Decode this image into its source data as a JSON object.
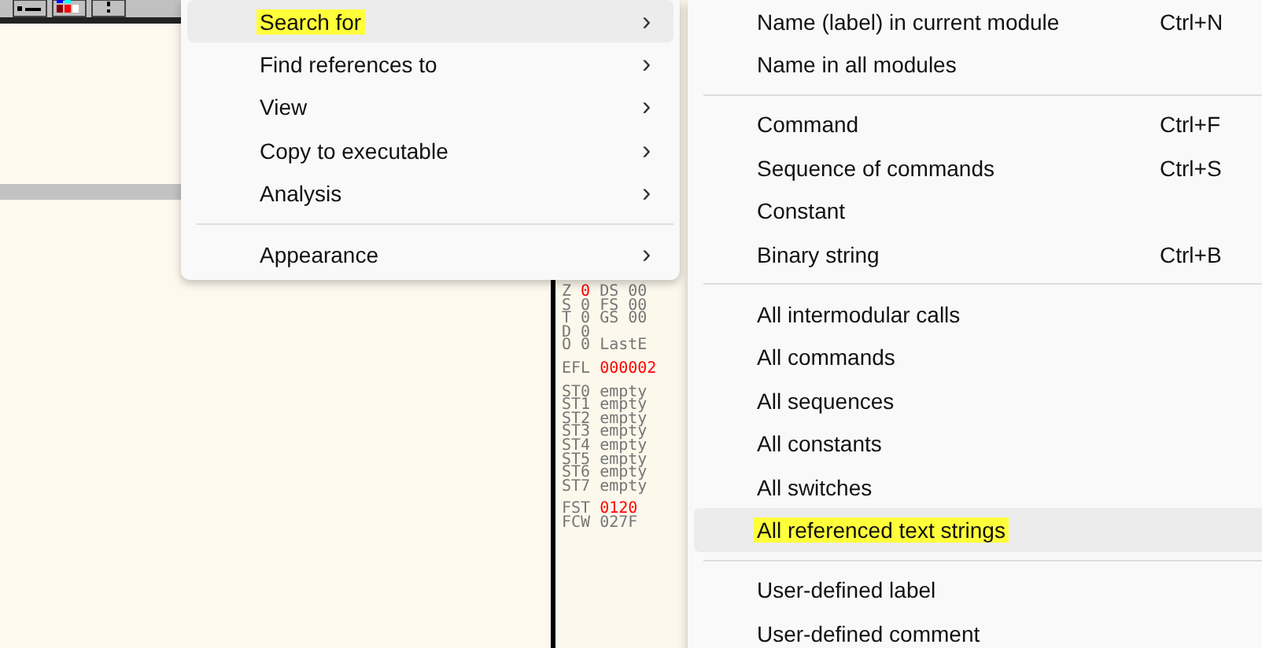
{
  "toolbar": {
    "buttons": [
      {
        "kind": "list"
      },
      {
        "kind": "colors"
      },
      {
        "kind": "help"
      }
    ]
  },
  "register_groups": [
    [
      {
        "parts": [
          {
            "text": "Z",
            "changed": false
          },
          {
            "text": "0",
            "changed": true
          },
          {
            "text": "DS 00",
            "changed": false
          }
        ]
      },
      {
        "parts": [
          {
            "text": "S",
            "changed": false
          },
          {
            "text": "0",
            "changed": false
          },
          {
            "text": "FS 00",
            "changed": false
          }
        ]
      },
      {
        "parts": [
          {
            "text": "T",
            "changed": false
          },
          {
            "text": "0",
            "changed": false
          },
          {
            "text": "GS 00",
            "changed": false
          }
        ]
      },
      {
        "parts": [
          {
            "text": "D",
            "changed": false
          },
          {
            "text": "0",
            "changed": false
          }
        ]
      },
      {
        "parts": [
          {
            "text": "O",
            "changed": false
          },
          {
            "text": "0",
            "changed": false
          },
          {
            "text": "LastE",
            "changed": false
          }
        ]
      }
    ],
    [
      {
        "parts": [
          {
            "text": "EFL",
            "changed": false
          },
          {
            "text": "000002",
            "changed": true
          }
        ]
      }
    ],
    [
      {
        "parts": [
          {
            "text": "ST0",
            "changed": false
          },
          {
            "text": "empty",
            "changed": false
          }
        ]
      },
      {
        "parts": [
          {
            "text": "ST1",
            "changed": false
          },
          {
            "text": "empty",
            "changed": false
          }
        ]
      },
      {
        "parts": [
          {
            "text": "ST2",
            "changed": false
          },
          {
            "text": "empty",
            "changed": false
          }
        ]
      },
      {
        "parts": [
          {
            "text": "ST3",
            "changed": false
          },
          {
            "text": "empty",
            "changed": false
          }
        ]
      },
      {
        "parts": [
          {
            "text": "ST4",
            "changed": false
          },
          {
            "text": "empty",
            "changed": false
          }
        ]
      },
      {
        "parts": [
          {
            "text": "ST5",
            "changed": false
          },
          {
            "text": "empty",
            "changed": false
          }
        ]
      },
      {
        "parts": [
          {
            "text": "ST6",
            "changed": false
          },
          {
            "text": "empty",
            "changed": false
          }
        ]
      },
      {
        "parts": [
          {
            "text": "ST7",
            "changed": false
          },
          {
            "text": "empty",
            "changed": false
          }
        ]
      }
    ],
    [
      {
        "parts": [
          {
            "text": "FST",
            "changed": false
          },
          {
            "text": "0120",
            "changed": true
          }
        ]
      },
      {
        "parts": [
          {
            "text": "FCW",
            "changed": false
          },
          {
            "text": "027F",
            "changed": false
          }
        ]
      }
    ]
  ],
  "context_menu": {
    "items": [
      {
        "kind": "item",
        "label": "Search for",
        "arrow": "›",
        "selected": true,
        "highlighted": true
      },
      {
        "kind": "item",
        "label": "Find references to",
        "arrow": "›",
        "selected": false,
        "highlighted": false
      },
      {
        "kind": "item",
        "label": "View",
        "arrow": "›",
        "selected": false,
        "highlighted": false
      },
      {
        "kind": "item",
        "label": "Copy to executable",
        "arrow": "›",
        "selected": false,
        "highlighted": false
      },
      {
        "kind": "item",
        "label": "Analysis",
        "arrow": "›",
        "selected": false,
        "highlighted": false
      },
      {
        "kind": "separator"
      },
      {
        "kind": "item",
        "label": "Appearance",
        "arrow": "›",
        "selected": false,
        "highlighted": false
      }
    ]
  },
  "submenu": {
    "items": [
      {
        "kind": "item",
        "label": "Name (label) in current module",
        "shortcut": "Ctrl+N",
        "selected": false,
        "highlighted": false
      },
      {
        "kind": "item",
        "label": "Name in all modules",
        "selected": false,
        "highlighted": false
      },
      {
        "kind": "separator"
      },
      {
        "kind": "item",
        "label": "Command",
        "shortcut": "Ctrl+F",
        "selected": false,
        "highlighted": false
      },
      {
        "kind": "item",
        "label": "Sequence of commands",
        "shortcut": "Ctrl+S",
        "selected": false,
        "highlighted": false
      },
      {
        "kind": "item",
        "label": "Constant",
        "selected": false,
        "highlighted": false
      },
      {
        "kind": "item",
        "label": "Binary string",
        "shortcut": "Ctrl+B",
        "selected": false,
        "highlighted": false
      },
      {
        "kind": "separator"
      },
      {
        "kind": "item",
        "label": "All intermodular calls",
        "selected": false,
        "highlighted": false
      },
      {
        "kind": "item",
        "label": "All commands",
        "selected": false,
        "highlighted": false
      },
      {
        "kind": "item",
        "label": "All sequences",
        "selected": false,
        "highlighted": false
      },
      {
        "kind": "item",
        "label": "All constants",
        "selected": false,
        "highlighted": false
      },
      {
        "kind": "item",
        "label": "All switches",
        "selected": false,
        "highlighted": false
      },
      {
        "kind": "item",
        "label": "All referenced text strings",
        "selected": true,
        "highlighted": true
      },
      {
        "kind": "separator"
      },
      {
        "kind": "item",
        "label": "User-defined label",
        "selected": false,
        "highlighted": false
      },
      {
        "kind": "item",
        "label": "User-defined comment",
        "selected": false,
        "highlighted": false
      }
    ]
  }
}
